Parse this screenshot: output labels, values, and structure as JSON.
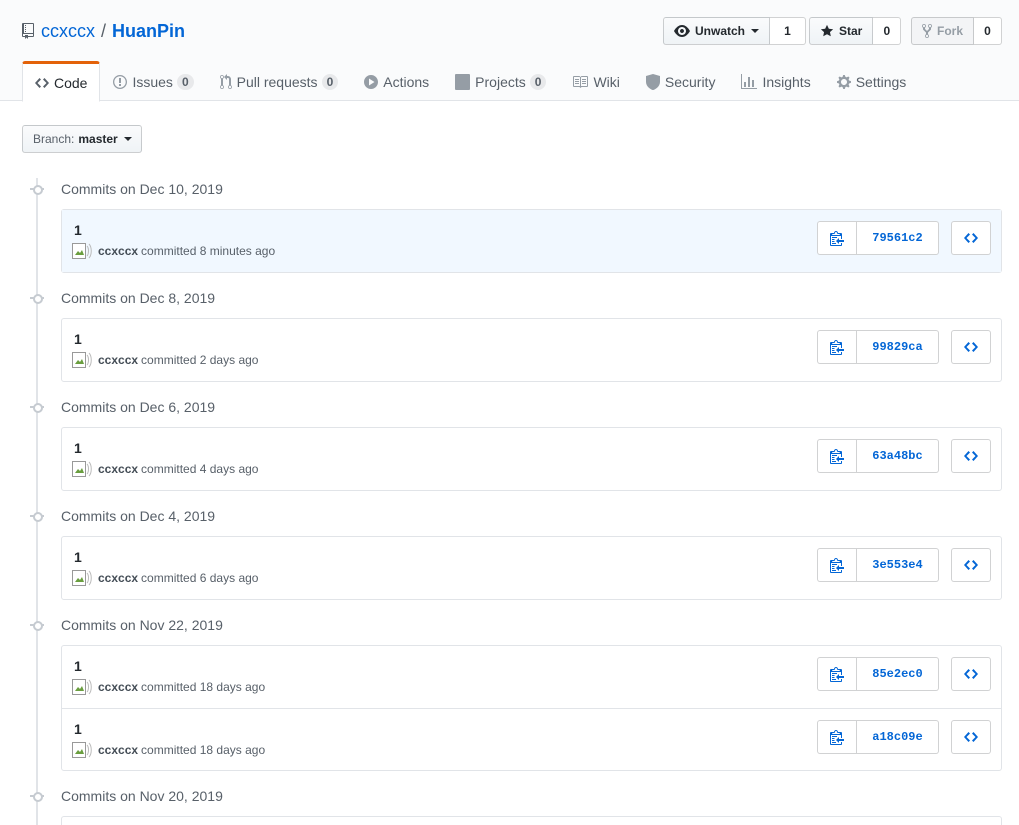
{
  "repo": {
    "owner": "ccxccx",
    "separator": "/",
    "name": "HuanPin"
  },
  "actions": {
    "watch": {
      "label": "Unwatch",
      "count": "1"
    },
    "star": {
      "label": "Star",
      "count": "0"
    },
    "fork": {
      "label": "Fork",
      "count": "0"
    }
  },
  "tabs": [
    {
      "label": "Code",
      "icon": "code-icon"
    },
    {
      "label": "Issues",
      "counter": "0",
      "icon": "issue-icon"
    },
    {
      "label": "Pull requests",
      "counter": "0",
      "icon": "pull-request-icon"
    },
    {
      "label": "Actions",
      "icon": "play-icon"
    },
    {
      "label": "Projects",
      "counter": "0",
      "icon": "project-icon"
    },
    {
      "label": "Wiki",
      "icon": "book-icon"
    },
    {
      "label": "Security",
      "icon": "shield-icon"
    },
    {
      "label": "Insights",
      "icon": "graph-icon"
    },
    {
      "label": "Settings",
      "icon": "gear-icon"
    }
  ],
  "branch": {
    "label": "Branch:",
    "value": "master"
  },
  "groups": [
    {
      "heading": "Commits on Dec 10, 2019",
      "commits": [
        {
          "message": "1",
          "author": "ccxccx",
          "verb": "committed",
          "time": "8 minutes ago",
          "sha": "79561c2"
        }
      ]
    },
    {
      "heading": "Commits on Dec 8, 2019",
      "commits": [
        {
          "message": "1",
          "author": "ccxccx",
          "verb": "committed",
          "time": "2 days ago",
          "sha": "99829ca"
        }
      ]
    },
    {
      "heading": "Commits on Dec 6, 2019",
      "commits": [
        {
          "message": "1",
          "author": "ccxccx",
          "verb": "committed",
          "time": "4 days ago",
          "sha": "63a48bc"
        }
      ]
    },
    {
      "heading": "Commits on Dec 4, 2019",
      "commits": [
        {
          "message": "1",
          "author": "ccxccx",
          "verb": "committed",
          "time": "6 days ago",
          "sha": "3e553e4"
        }
      ]
    },
    {
      "heading": "Commits on Nov 22, 2019",
      "commits": [
        {
          "message": "1",
          "author": "ccxccx",
          "verb": "committed",
          "time": "18 days ago",
          "sha": "85e2ec0"
        },
        {
          "message": "1",
          "author": "ccxccx",
          "verb": "committed",
          "time": "18 days ago",
          "sha": "a18c09e"
        }
      ]
    },
    {
      "heading": "Commits on Nov 20, 2019",
      "commits": []
    }
  ],
  "colors": {
    "link": "#0366d6",
    "tab_accent": "#e36209",
    "highlight_row": "#f1f8ff"
  }
}
